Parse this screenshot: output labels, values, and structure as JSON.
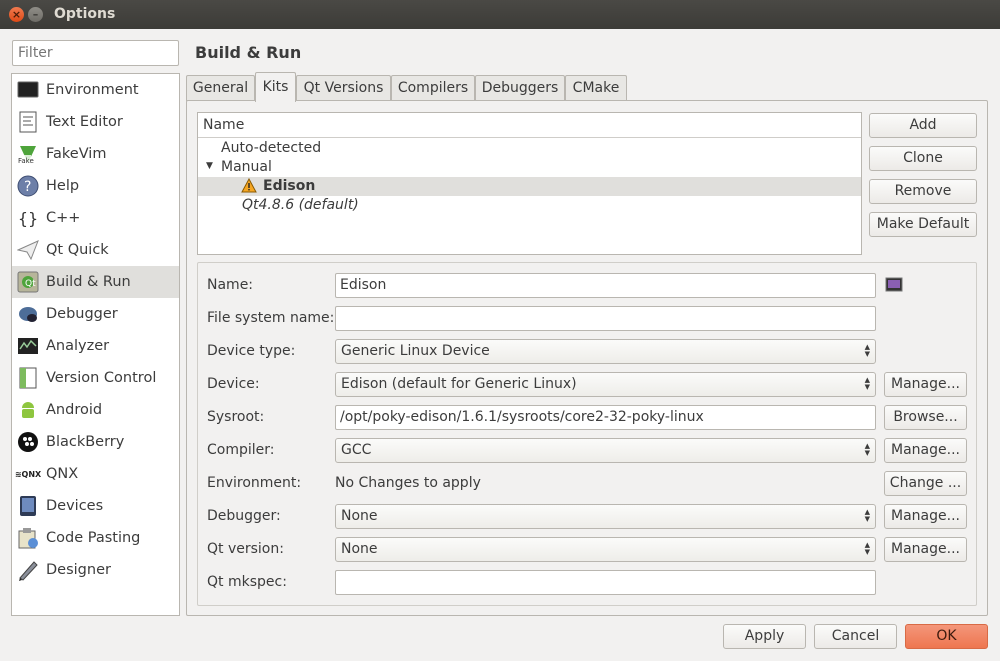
{
  "window": {
    "title": "Options"
  },
  "filter": {
    "placeholder": "Filter"
  },
  "categories": [
    {
      "label": "Environment",
      "icon": "monitor-icon"
    },
    {
      "label": "Text Editor",
      "icon": "text-editor-icon"
    },
    {
      "label": "FakeVim",
      "icon": "fakevim-icon"
    },
    {
      "label": "Help",
      "icon": "help-icon"
    },
    {
      "label": "C++",
      "icon": "cpp-braces-icon"
    },
    {
      "label": "Qt Quick",
      "icon": "paper-plane-icon"
    },
    {
      "label": "Build & Run",
      "icon": "build-run-icon"
    },
    {
      "label": "Debugger",
      "icon": "bug-icon"
    },
    {
      "label": "Analyzer",
      "icon": "analyzer-icon"
    },
    {
      "label": "Version Control",
      "icon": "version-control-icon"
    },
    {
      "label": "Android",
      "icon": "android-icon"
    },
    {
      "label": "BlackBerry",
      "icon": "blackberry-icon"
    },
    {
      "label": "QNX",
      "icon": "qnx-icon"
    },
    {
      "label": "Devices",
      "icon": "device-icon"
    },
    {
      "label": "Code Pasting",
      "icon": "code-pasting-icon"
    },
    {
      "label": "Designer",
      "icon": "designer-icon"
    }
  ],
  "page": {
    "title": "Build & Run"
  },
  "tabs": [
    "General",
    "Kits",
    "Qt Versions",
    "Compilers",
    "Debuggers",
    "CMake"
  ],
  "kits": {
    "header": "Name",
    "auto_detected": "Auto-detected",
    "manual": "Manual",
    "edison": "Edison",
    "qt_default": "Qt4.8.6 (default)"
  },
  "kit_buttons": {
    "add": "Add",
    "clone": "Clone",
    "remove": "Remove",
    "make_default": "Make Default"
  },
  "form": {
    "name_label": "Name:",
    "name_value": "Edison",
    "fs_label": "File system name:",
    "fs_value": "",
    "device_type_label": "Device type:",
    "device_type_value": "Generic Linux Device",
    "device_label": "Device:",
    "device_value": "Edison (default for Generic Linux)",
    "sysroot_label": "Sysroot:",
    "sysroot_value": "/opt/poky-edison/1.6.1/sysroots/core2-32-poky-linux",
    "compiler_label": "Compiler:",
    "compiler_value": "GCC",
    "env_label": "Environment:",
    "env_value": "No Changes to apply",
    "debugger_label": "Debugger:",
    "debugger_value": "None",
    "qtver_label": "Qt version:",
    "qtver_value": "None",
    "mkspec_label": "Qt mkspec:",
    "mkspec_value": ""
  },
  "side_buttons": {
    "manage": "Manage...",
    "browse": "Browse...",
    "change": "Change ..."
  },
  "footer": {
    "apply": "Apply",
    "cancel": "Cancel",
    "ok": "OK"
  },
  "colors": {
    "accent": "#ee7650",
    "titlebar": "#3c3b37",
    "selected_row": "#e0dfdc"
  }
}
